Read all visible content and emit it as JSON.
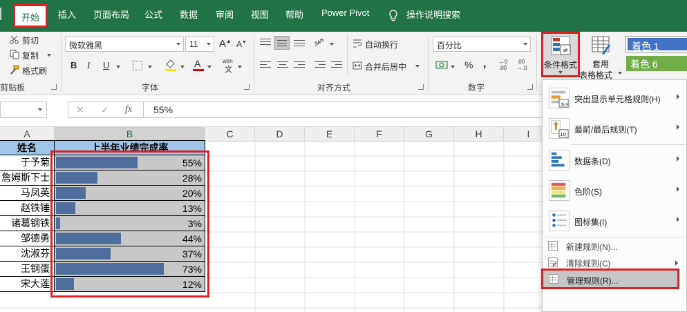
{
  "tabs": {
    "home": "开始",
    "insert": "插入",
    "page_layout": "页面布局",
    "formulas": "公式",
    "data": "数据",
    "review": "审阅",
    "view": "视图",
    "help": "帮助",
    "power_pivot": "Power Pivot",
    "tell_me": "操作说明搜索"
  },
  "clipboard": {
    "cut": "剪切",
    "copy": "复制",
    "format_painter": "格式刷",
    "group_label": "剪贴板"
  },
  "font": {
    "name": "微软雅黑",
    "size": "11",
    "grow": "A",
    "shrink": "A",
    "bold": "B",
    "italic": "I",
    "underline": "U",
    "color_letter": "A",
    "phonetic_top": "wén",
    "phonetic_bottom": "文",
    "group_label": "字体"
  },
  "alignment": {
    "wrap": "自动换行",
    "merge": "合并后居中",
    "group_label": "对齐方式"
  },
  "number": {
    "format": "百分比",
    "percent": "%",
    "comma": ",",
    "inc_top": "←0",
    "inc_bottom": ".00",
    "dec_top": ".00",
    "dec_bottom": "→.0",
    "group_label": "数字"
  },
  "styles": {
    "cond_format": "条件格式",
    "table_top": "套用",
    "table_bottom": "表格格式",
    "accent1": "着色 1",
    "accent6": "着色 6"
  },
  "formula_bar": {
    "cancel": "✕",
    "enter": "✓",
    "fx": "fx",
    "value": "55%"
  },
  "columns": [
    "A",
    "B",
    "C",
    "D",
    "E",
    "F",
    "G",
    "H",
    "I"
  ],
  "sheet": {
    "header_name": "姓名",
    "header_rate": "上半年业绩完成率",
    "rows": [
      {
        "name": "于予菊",
        "pct": "55%",
        "value": 0.55
      },
      {
        "name": "詹姆斯下士",
        "pct": "28%",
        "value": 0.28
      },
      {
        "name": "马凤英",
        "pct": "20%",
        "value": 0.2
      },
      {
        "name": "赵铁锤",
        "pct": "13%",
        "value": 0.13
      },
      {
        "name": "诸葛钢铁",
        "pct": "3%",
        "value": 0.03
      },
      {
        "name": "邹德勇",
        "pct": "44%",
        "value": 0.44
      },
      {
        "name": "沈淑芬",
        "pct": "37%",
        "value": 0.37
      },
      {
        "name": "王钢蛋",
        "pct": "73%",
        "value": 0.73
      },
      {
        "name": "宋大莲",
        "pct": "12%",
        "value": 0.12
      }
    ]
  },
  "menu": {
    "highlight": "突出显示单元格规则(H)",
    "topbottom": "最前/最后规则(T)",
    "databar": "数据条(D)",
    "colorscale": "色阶(S)",
    "iconset": "图标集(I)",
    "new_rule": "新建规则(N)...",
    "clear_rules": "清除规则(C)",
    "manage_rules": "管理规则(R)..."
  },
  "colors": {
    "excel_green": "#217346",
    "highlight_red": "#e02020",
    "data_bar": "#4e6e9e",
    "header_fill": "#9fc5e8",
    "accent1": "#4472c4",
    "accent6": "#70ad47"
  }
}
